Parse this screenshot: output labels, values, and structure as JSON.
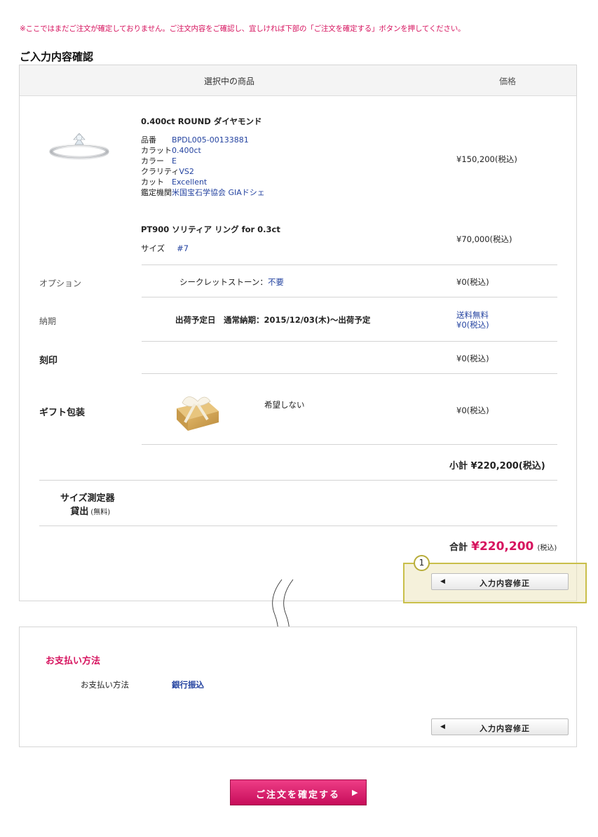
{
  "notice": "※ここではまだご注文が確定しておりません。ご注文内容をご確認し、宜しければ下部の「ご注文を確定する」ボタンを押してください。",
  "section_title": "ご入力内容確認",
  "table_header": {
    "product": "選択中の商品",
    "price": "価格"
  },
  "diamond": {
    "title": "0.400ct ROUND ダイヤモンド",
    "specs": [
      {
        "key": "品番",
        "value": "BPDL005-00133881"
      },
      {
        "key": "カラット",
        "value": "0.400ct"
      },
      {
        "key": "カラー",
        "value": "E"
      },
      {
        "key": "クラリティ",
        "value": "VS2"
      },
      {
        "key": "カット",
        "value": "Excellent"
      },
      {
        "key": "鑑定機関",
        "value": "米国宝石学協会 GIAドシェ"
      }
    ],
    "price": "¥150,200(税込)"
  },
  "ring": {
    "title": "PT900 ソリティア リング for 0.3ct",
    "size_label": "サイズ",
    "size_value": "#7",
    "price": "¥70,000(税込)"
  },
  "option": {
    "label": "オプション",
    "name": "シークレットストーン：",
    "value": "不要",
    "price": "¥0(税込)"
  },
  "delivery": {
    "label": "納期",
    "text": "出荷予定日　通常納期：2015/12/03(木)〜出荷予定",
    "shipping": "送料無料",
    "price": "¥0(税込)"
  },
  "engraving": {
    "label": "刻印",
    "price": "¥0(税込)"
  },
  "gift": {
    "label": "ギフト包装",
    "value": "希望しない",
    "price": "¥0(税込)"
  },
  "subtotal": "小計 ¥220,200(税込)",
  "size_tool": {
    "line1": "サイズ測定器",
    "line2": "貸出",
    "note": "(無料)"
  },
  "total": {
    "label": "合計",
    "value": "¥220,200",
    "tax": "(税込)"
  },
  "edit_button": {
    "arrow": "◀",
    "label": "入力内容修正"
  },
  "badge": "1",
  "payment": {
    "title": "お支払い方法",
    "label": "お支払い方法",
    "value": "銀行振込"
  },
  "confirm_button": {
    "label": "ご注文を確定する",
    "arrow": "▶"
  }
}
